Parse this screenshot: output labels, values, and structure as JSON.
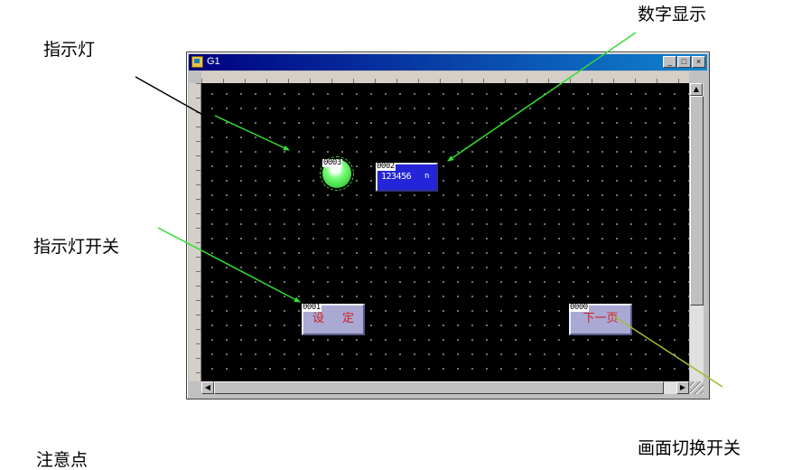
{
  "callouts": {
    "indicator": "指示灯",
    "numeric_display": "数字显示",
    "indicator_switch": "指示灯开关",
    "screen_switch": "画面切换开关",
    "note": "注意点"
  },
  "window": {
    "title": "G1",
    "buttons": {
      "minimize": "_",
      "maximize": "□",
      "close": "×"
    }
  },
  "objects": {
    "lamp": {
      "id": "0003",
      "color": "#1ed21e"
    },
    "numeric_display": {
      "id": "0002",
      "value": "123456",
      "unit": "n"
    },
    "set_button": {
      "id": "0001",
      "label": "设 定"
    },
    "next_page_button": {
      "id": "0000",
      "label": "下一页"
    }
  },
  "colors": {
    "canvas": "#000000",
    "display_bg": "#2424d8",
    "button_bg": "#a9a9d4",
    "button_text": "#d41c1c",
    "arrow_green": "#33dd33"
  }
}
